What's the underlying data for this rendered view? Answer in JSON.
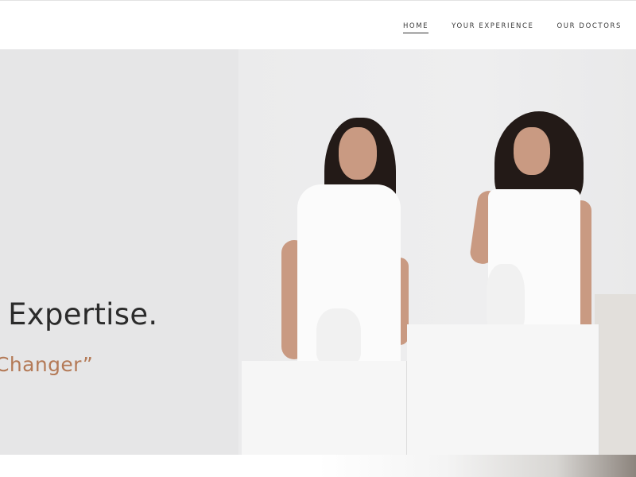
{
  "nav": {
    "items": [
      {
        "label": "HOME",
        "active": true
      },
      {
        "label": "YOUR EXPERIENCE",
        "active": false
      },
      {
        "label": "OUR DOCTORS",
        "active": false
      }
    ]
  },
  "hero": {
    "headline": "’ Expertise.",
    "subline": "Changer”",
    "accent_color": "#b47a57"
  }
}
